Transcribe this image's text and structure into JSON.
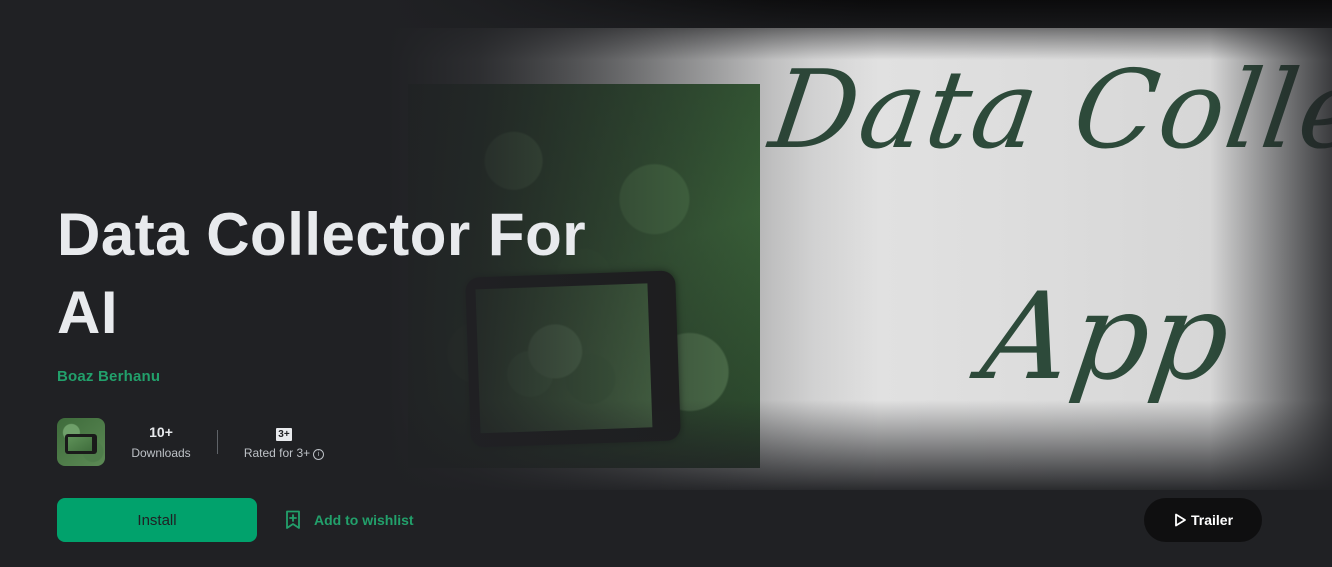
{
  "app": {
    "title": "Data Collector For AI",
    "developer": "Boaz Berhanu",
    "icon": "app-icon"
  },
  "banner": {
    "script_line1": "Data Collector",
    "script_line2": "App"
  },
  "stats": {
    "downloads_value": "10+",
    "downloads_label": "Downloads",
    "rating_badge": "3+",
    "rating_label": "Rated for 3+",
    "info_icon": "info-icon"
  },
  "actions": {
    "install_label": "Install",
    "wishlist_label": "Add to wishlist",
    "wishlist_icon": "bookmark-add-icon",
    "trailer_label": "Trailer",
    "trailer_icon": "play-icon"
  },
  "colors": {
    "accent": "#01a26c",
    "link": "#22a06b",
    "background": "#202124",
    "text": "#e8eaed"
  }
}
